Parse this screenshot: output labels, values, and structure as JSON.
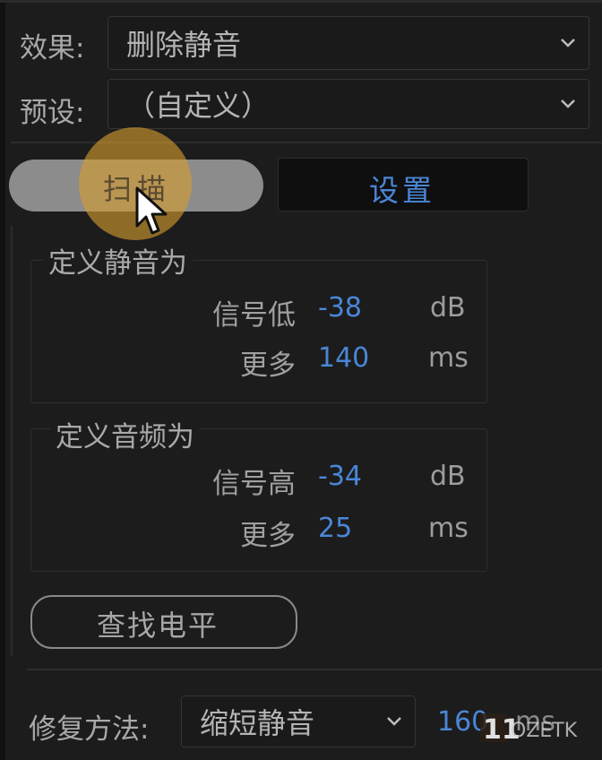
{
  "effect": {
    "label": "效果:",
    "value": "删除静音"
  },
  "preset": {
    "label": "预设:",
    "value": "（自定义）"
  },
  "tabs": {
    "scan": "扫描",
    "settings": "设置"
  },
  "silence": {
    "title": "定义静音为",
    "signal_label": "信号低",
    "signal_value": "-38",
    "signal_unit": "dB",
    "more_label": "更多",
    "more_value": "140",
    "more_unit": "ms"
  },
  "audio": {
    "title": "定义音频为",
    "signal_label": "信号高",
    "signal_value": "-34",
    "signal_unit": "dB",
    "more_label": "更多",
    "more_value": "25",
    "more_unit": "ms"
  },
  "find_level_button": "查找电平",
  "repair": {
    "label": "修复方法:",
    "value": "缩短静音",
    "amount": "160",
    "amount_unit": "ms"
  },
  "colors": {
    "accent": "#4a86d6",
    "background": "#1c1c1c",
    "highlight": "#d8a73a"
  },
  "watermark": {
    "text": "11 OZETK"
  }
}
